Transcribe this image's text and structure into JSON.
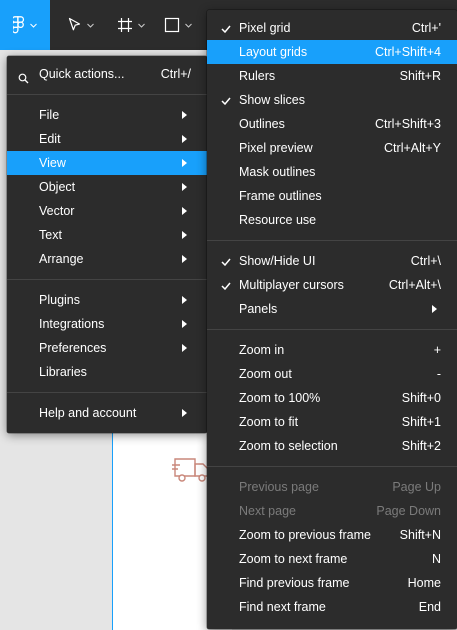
{
  "toolbar": {
    "tools": [
      {
        "icon": "figma-logo-icon",
        "active": true
      },
      {
        "icon": "move-cursor-icon",
        "active": false
      },
      {
        "icon": "frame-hash-icon",
        "active": false
      },
      {
        "icon": "rectangle-icon",
        "active": false
      }
    ]
  },
  "main_menu": {
    "quick_actions": {
      "label": "Quick actions...",
      "shortcut": "Ctrl+/",
      "icon": "search-icon"
    },
    "items_group1": [
      {
        "label": "File"
      },
      {
        "label": "Edit"
      },
      {
        "label": "View",
        "highlight": true
      },
      {
        "label": "Object"
      },
      {
        "label": "Vector"
      },
      {
        "label": "Text"
      },
      {
        "label": "Arrange"
      }
    ],
    "items_group2": [
      {
        "label": "Plugins"
      },
      {
        "label": "Integrations"
      },
      {
        "label": "Preferences"
      },
      {
        "label": "Libraries"
      }
    ],
    "items_group3": [
      {
        "label": "Help and account"
      }
    ]
  },
  "view_menu": {
    "group1": [
      {
        "label": "Pixel grid",
        "shortcut": "Ctrl+'",
        "checked": true
      },
      {
        "label": "Layout grids",
        "shortcut": "Ctrl+Shift+4",
        "highlight": true
      },
      {
        "label": "Rulers",
        "shortcut": "Shift+R"
      },
      {
        "label": "Show slices",
        "shortcut": "",
        "checked": true
      },
      {
        "label": "Outlines",
        "shortcut": "Ctrl+Shift+3"
      },
      {
        "label": "Pixel preview",
        "shortcut": "Ctrl+Alt+Y"
      },
      {
        "label": "Mask outlines",
        "shortcut": ""
      },
      {
        "label": "Frame outlines",
        "shortcut": ""
      },
      {
        "label": "Resource use",
        "shortcut": ""
      }
    ],
    "group2": [
      {
        "label": "Show/Hide UI",
        "shortcut": "Ctrl+\\",
        "checked": true
      },
      {
        "label": "Multiplayer cursors",
        "shortcut": "Ctrl+Alt+\\",
        "checked": true
      },
      {
        "label": "Panels",
        "shortcut": "",
        "submenu": true
      }
    ],
    "group3": [
      {
        "label": "Zoom in",
        "shortcut": "+"
      },
      {
        "label": "Zoom out",
        "shortcut": "-"
      },
      {
        "label": "Zoom to 100%",
        "shortcut": "Shift+0"
      },
      {
        "label": "Zoom to fit",
        "shortcut": "Shift+1"
      },
      {
        "label": "Zoom to selection",
        "shortcut": "Shift+2"
      }
    ],
    "group4": [
      {
        "label": "Previous page",
        "shortcut": "Page Up",
        "disabled": true
      },
      {
        "label": "Next page",
        "shortcut": "Page Down",
        "disabled": true
      },
      {
        "label": "Zoom to previous frame",
        "shortcut": "Shift+N"
      },
      {
        "label": "Zoom to next frame",
        "shortcut": "N"
      },
      {
        "label": "Find previous frame",
        "shortcut": "Home"
      },
      {
        "label": "Find next frame",
        "shortcut": "End"
      }
    ]
  },
  "colors": {
    "accent": "#18a0fb",
    "menu_bg": "#2c2c2c",
    "disabled_text": "#7b7b7b",
    "canvas_bg": "#e5e5e5"
  }
}
